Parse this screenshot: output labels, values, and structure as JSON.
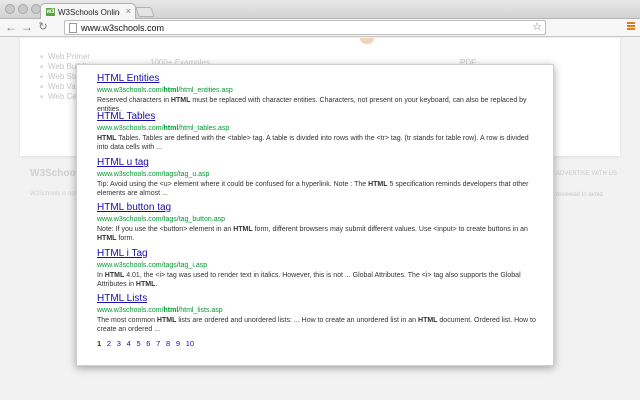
{
  "browser": {
    "tab": {
      "title": "W3Schools Online Web Tu",
      "favicon_text": "w3"
    },
    "url": "www.w3schools.com"
  },
  "background": {
    "nav_links": [
      "Web Primer",
      "Web Building",
      "Web Statistics",
      "Web Validation",
      "Web Certificates"
    ],
    "mid_text": "1000+ Examples",
    "pdf_text": "PDF",
    "footer_logo": "W3Schools",
    "footer_left": "W3Schools is optimized for learning, testing, and training.",
    "footer_right": "ADVERTISE WITH US",
    "footer_right2": "reviewed to avoid"
  },
  "results": [
    {
      "title": "HTML Entities",
      "url": "www.w3schools.com/html/html_entities.asp",
      "snippet": "Reserved characters in HTML must be replaced with character entities. Characters, not present on your keyboard, can also be replaced by entities."
    },
    {
      "title": "HTML Tables",
      "url": "www.w3schools.com/html/html_tables.asp",
      "snippet": "HTML Tables. Tables are defined with the <table> tag. A table is divided into rows with the <tr> tag. (tr stands for table row). A row is divided into data cells with ..."
    },
    {
      "title": "HTML u tag",
      "url": "www.w3schools.com/tags/tag_u.asp",
      "snippet": "Tip: Avoid using the <u> element where it could be confused for a hyperlink. Note : The HTML 5 specification reminds developers that other elements are almost ..."
    },
    {
      "title": "HTML button tag",
      "url": "www.w3schools.com/tags/tag_button.asp",
      "snippet": "Note: If you use the <button> element in an HTML form, different browsers may submit different values. Use <input> to create buttons in an HTML form."
    },
    {
      "title": "HTML i Tag",
      "url": "www.w3schools.com/tags/tag_i.asp",
      "snippet": "In HTML 4.01, the <i> tag was used to render text in italics. However, this is not ... Global Attributes. The <i> tag also supports the Global Attributes in HTML."
    },
    {
      "title": "HTML Lists",
      "url": "www.w3schools.com/html/html_lists.asp",
      "snippet": "The most common HTML lists are ordered and unordered lists: ... How to create an unordered list in an HTML document. Ordered list. How to create an ordered ..."
    }
  ],
  "pagination": [
    "1",
    "2",
    "3",
    "4",
    "5",
    "6",
    "7",
    "8",
    "9",
    "10"
  ],
  "current_page": "1",
  "colors": {
    "link": "#1a0dab",
    "url_green": "#009933",
    "brand": "#5aa63e"
  }
}
